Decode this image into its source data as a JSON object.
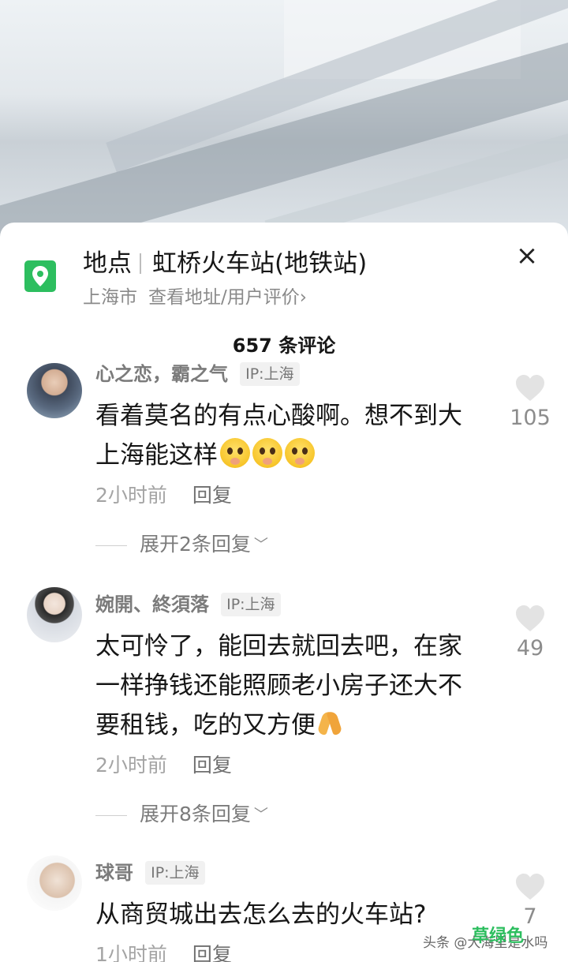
{
  "location": {
    "prefix": "地点",
    "name": "虹桥火车站(地铁站)",
    "city": "上海市",
    "link": "查看地址/用户评价",
    "link_chevron": "›",
    "close": "×"
  },
  "comments_header": "657 条评论",
  "comments": [
    {
      "username": "心之恋，霸之气",
      "ip": "IP:上海",
      "text": "看着莫名的有点心酸啊。想不到大上海能这样",
      "time": "2小时前",
      "reply": "回复",
      "expand": "展开2条回复",
      "likes": "105"
    },
    {
      "username": "婉開、終須落",
      "ip": "IP:上海",
      "text": "太可怜了，能回去就回去吧，在家一样挣钱还能照顾老小房子还大不要租钱，吃的又方便",
      "time": "2小时前",
      "reply": "回复",
      "expand": "展开8条回复",
      "likes": "49"
    },
    {
      "username": "球哥",
      "ip": "IP:上海",
      "text": "从商贸城出去怎么去的火车站?",
      "time": "1小时前",
      "reply": "回复",
      "likes": "7"
    }
  ],
  "watermark": {
    "text": "头条 @大海里是水吗",
    "overlay": "草绿色"
  },
  "colors": {
    "accent_green": "#2dbe5f",
    "secondary_text": "#8a8a8a"
  }
}
